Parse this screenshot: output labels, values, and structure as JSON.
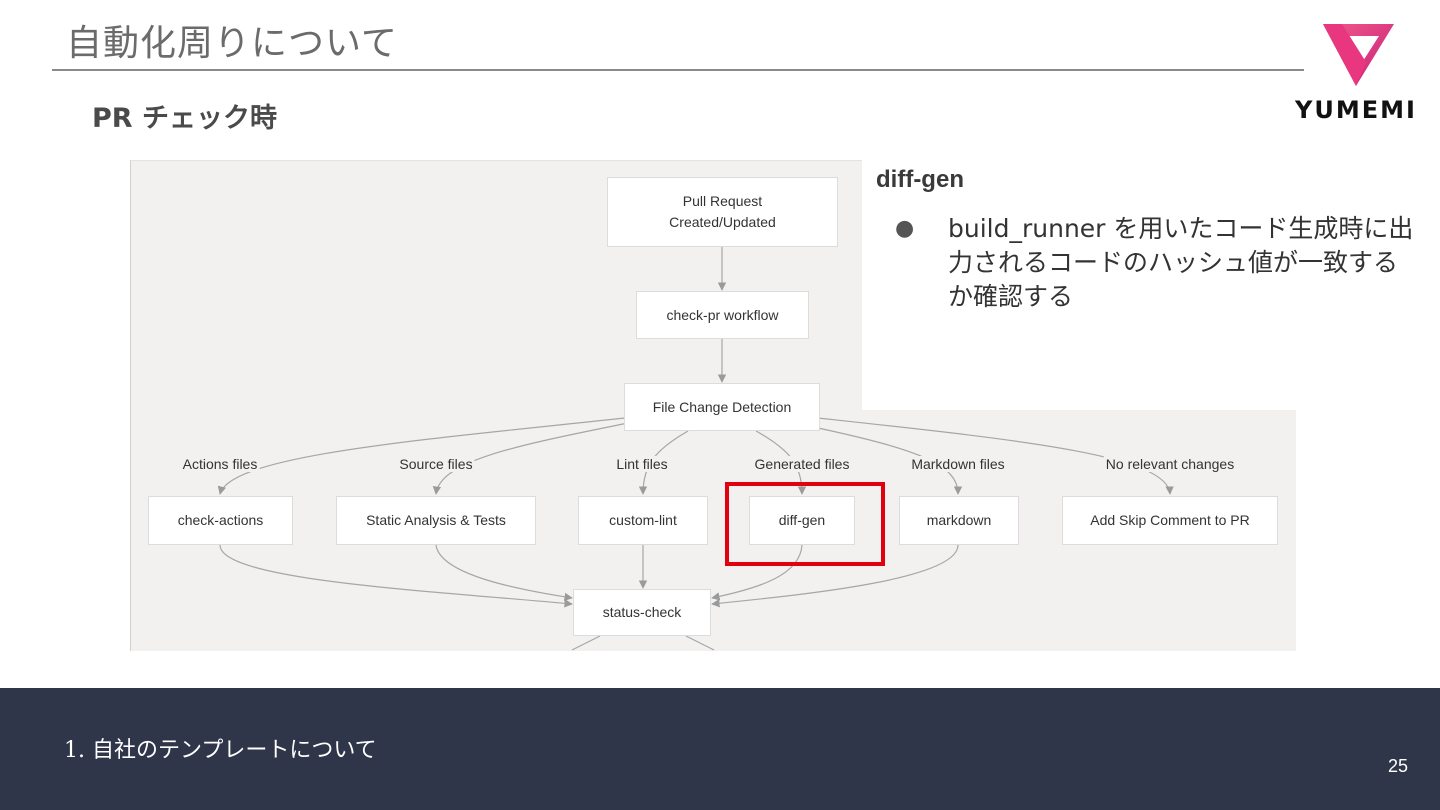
{
  "slide": {
    "title": "自動化周りについて",
    "subtitle": "PR チェック時",
    "logo_text": "YUMEMI",
    "brand_color": "#e8367f"
  },
  "diagram": {
    "nodes": {
      "pull_request": "Pull Request\nCreated/Updated",
      "check_pr": "check-pr workflow",
      "file_change": "File Change Detection",
      "check_actions": "check-actions",
      "static_analysis": "Static Analysis & Tests",
      "custom_lint": "custom-lint",
      "diff_gen": "diff-gen",
      "markdown": "markdown",
      "skip_comment": "Add Skip Comment to PR",
      "status_check": "status-check"
    },
    "edge_labels": {
      "actions_files": "Actions files",
      "source_files": "Source files",
      "lint_files": "Lint files",
      "generated_files": "Generated files",
      "markdown_files": "Markdown files",
      "no_relevant": "No relevant changes"
    },
    "highlight_color": "#e0000f"
  },
  "side_panel": {
    "heading": "diff-gen",
    "bullet_symbol": "●",
    "bullet_text": "build_runner を用いたコード生成時に出力されるコードのハッシュ値が一致するか確認する"
  },
  "footer": {
    "item": "1.  自社のテンプレートについて",
    "page_number": "25"
  }
}
